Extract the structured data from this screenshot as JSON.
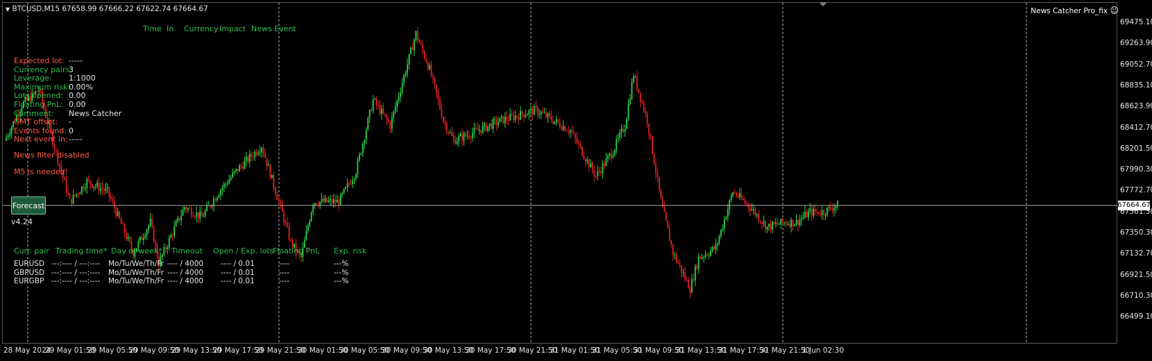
{
  "symbol_bar": {
    "dropdown_glyph": "▼",
    "text": "BTCUSD,M15  67658.99 67666.22 67622.74 67664.67"
  },
  "indicator_name": "News Catcher Pro_fix",
  "smiley_glyph": "☺",
  "news_header": [
    "Time",
    "In",
    "Currency",
    "Impact",
    "News Event"
  ],
  "info": [
    {
      "label": "Expected lot:",
      "value": "-----",
      "label_color": "#ff5a4a"
    },
    {
      "label": "Currency pairs:",
      "value": "3",
      "label_color": "#2fbf4f"
    },
    {
      "label": "Leverage:",
      "value": "1:1000",
      "label_color": "#2fbf4f"
    },
    {
      "label": "Maximum risk:",
      "value": "0.00%",
      "label_color": "#2fbf4f"
    },
    {
      "label": "Lots opened:",
      "value": "0.00",
      "label_color": "#2fbf4f"
    },
    {
      "label": "Floating PnL:",
      "value": "0.00",
      "label_color": "#2fbf4f"
    },
    {
      "label": "Comment:",
      "value": "News Catcher",
      "label_color": "#2fbf4f"
    },
    {
      "label": "GMT offset:",
      "value": "-",
      "label_color": "#ff5a4a"
    },
    {
      "label": "Events found:",
      "value": "0",
      "label_color": "#ff5a4a"
    },
    {
      "label": "Next event in:",
      "value": "-----",
      "label_color": "#ff5a4a"
    }
  ],
  "warnings": [
    "News filter disabled",
    "M5 is needed!"
  ],
  "forecast_button": "Forecast",
  "version": "v4.24",
  "table": {
    "headers": [
      "Curr. pair",
      "Trading time*",
      "Day of week*",
      "Timeout",
      "Open / Exp. lots",
      "Floating PnL",
      "Exp. risk"
    ],
    "rows": [
      [
        "EURUSD",
        "---:---- / ---:----",
        "Mo/Tu/We/Th/Fr",
        "---- / 4000",
        "---- / 0.01",
        "----",
        "---%"
      ],
      [
        "GBPUSD",
        "---:---- / ---:----",
        "Mo/Tu/We/Th/Fr",
        "---- / 4000",
        "---- / 0.01",
        "----",
        "---%"
      ],
      [
        "EURGBP",
        "---:---- / ---:----",
        "Mo/Tu/We/Th/Fr",
        "---- / 4000",
        "---- / 0.01",
        "----",
        "---%"
      ]
    ]
  },
  "current_price": "67664.67",
  "chart_data": {
    "type": "candlestick",
    "y_axis_labels": [
      "69475.10",
      "69263.90",
      "69052.70",
      "68835.10",
      "68623.90",
      "68412.70",
      "68201.50",
      "67990.30",
      "67772.70",
      "67561.50",
      "67350.30",
      "67132.70",
      "66921.50",
      "66710.30",
      "66499.10"
    ],
    "x_axis_labels": [
      "28 May 2024",
      "29 May 01:50",
      "29 May 05:50",
      "29 May 09:50",
      "29 May 13:50",
      "29 May 17:50",
      "29 May 21:50",
      "30 May 01:50",
      "30 May 05:50",
      "30 May 09:50",
      "30 May 13:50",
      "30 May 17:50",
      "30 May 21:50",
      "31 May 01:50",
      "31 May 05:50",
      "31 May 09:50",
      "31 May 13:50",
      "31 May 17:50",
      "31 May 21:50",
      "1 Jun 02:30"
    ],
    "ylim": [
      66499.1,
      69475.1
    ],
    "key_points": [
      [
        0,
        68300
      ],
      [
        10,
        68650
      ],
      [
        20,
        68800
      ],
      [
        28,
        68300
      ],
      [
        38,
        67700
      ],
      [
        48,
        67900
      ],
      [
        60,
        67800
      ],
      [
        70,
        67400
      ],
      [
        75,
        67200
      ],
      [
        85,
        67500
      ],
      [
        90,
        67100
      ],
      [
        98,
        67400
      ],
      [
        105,
        67650
      ],
      [
        115,
        67550
      ],
      [
        125,
        67800
      ],
      [
        135,
        68000
      ],
      [
        150,
        68250
      ],
      [
        160,
        67700
      ],
      [
        167,
        67300
      ],
      [
        173,
        67150
      ],
      [
        180,
        67700
      ],
      [
        195,
        67700
      ],
      [
        205,
        68000
      ],
      [
        215,
        68700
      ],
      [
        225,
        68450
      ],
      [
        240,
        69350
      ],
      [
        248,
        69000
      ],
      [
        256,
        68500
      ],
      [
        262,
        68300
      ],
      [
        290,
        68500
      ],
      [
        310,
        68600
      ],
      [
        330,
        68400
      ],
      [
        345,
        67950
      ],
      [
        355,
        68200
      ],
      [
        362,
        68450
      ],
      [
        367,
        68950
      ],
      [
        375,
        68500
      ],
      [
        383,
        67700
      ],
      [
        390,
        67200
      ],
      [
        400,
        66850
      ],
      [
        405,
        67150
      ],
      [
        415,
        67250
      ],
      [
        425,
        67800
      ],
      [
        435,
        67650
      ],
      [
        445,
        67450
      ],
      [
        455,
        67500
      ],
      [
        462,
        67500
      ],
      [
        470,
        67600
      ],
      [
        478,
        67600
      ],
      [
        485,
        67665
      ]
    ],
    "up_color": "#2fd34a",
    "down_color": "#e02424",
    "grid": "vertical dashed",
    "price_line": 67664.67
  },
  "colors": {
    "background": "#000000",
    "bull": "#2fd34a",
    "bear": "#e02424",
    "text_green": "#2fbf4f",
    "text_red": "#ff5a4a",
    "button_bg": "#1f5a3a"
  }
}
